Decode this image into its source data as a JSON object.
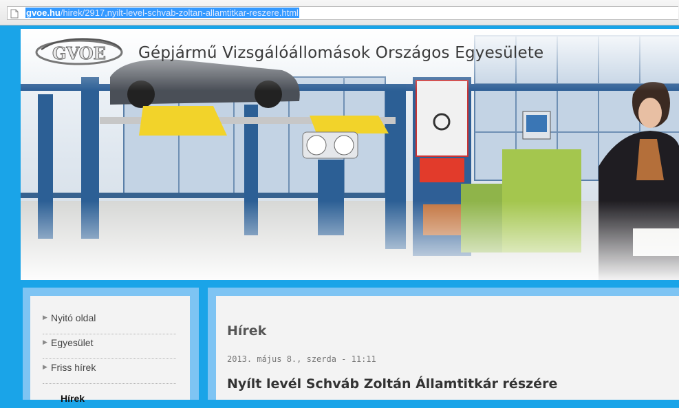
{
  "browser": {
    "url_host": "gvoe.hu",
    "url_path": "/hirek/2917,nyilt-level-schvab-zoltan-allamtitkar-reszere.html"
  },
  "header": {
    "logo_text": "GVOE",
    "site_title": "Gépjármű Vizsgálóállomások Országos Egyesülete"
  },
  "sidebar": {
    "items": [
      {
        "label": "Nyitó oldal"
      },
      {
        "label": "Egyesület"
      },
      {
        "label": "Friss hírek"
      },
      {
        "label": "Hírek"
      }
    ]
  },
  "main": {
    "section_title": "Hírek",
    "article_date": "2013. május 8., szerda - 11:11",
    "article_title": "Nyílt levél Schváb Zoltán Államtitkár részére"
  },
  "colors": {
    "page_background": "#1aa4e8",
    "frame": "#7ec4f3",
    "panel": "#f3f3f3",
    "url_highlight": "#3399ff",
    "lift_yellow": "#f2d32a",
    "equipment_blue": "#2c5f95"
  }
}
